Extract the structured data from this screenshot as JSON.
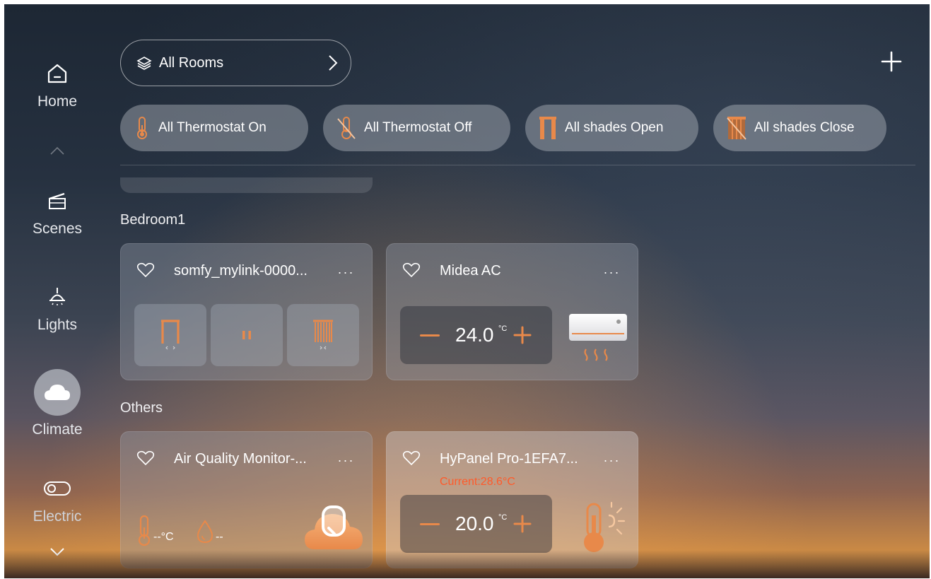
{
  "nav": {
    "items": [
      {
        "label": "Home",
        "icon": "home-icon"
      },
      {
        "label": "Scenes",
        "icon": "clapperboard-icon"
      },
      {
        "label": "Lights",
        "icon": "ceiling-lamp-icon"
      },
      {
        "label": "Climate",
        "icon": "cloud-icon",
        "active": true
      },
      {
        "label": "Electric",
        "icon": "toggle-icon"
      }
    ]
  },
  "header": {
    "rooms_label": "All Rooms",
    "rooms_icon": "layers-icon",
    "add_icon": "plus-icon"
  },
  "quick_actions": [
    {
      "label": "All Thermostat On",
      "icon": "thermometer-icon"
    },
    {
      "label": "All Thermostat Off",
      "icon": "thermometer-off-icon"
    },
    {
      "label": "All shades Open",
      "icon": "shade-open-icon"
    },
    {
      "label": "All shades Close",
      "icon": "shade-close-icon"
    }
  ],
  "sections": [
    {
      "title": "Bedroom1",
      "devices": [
        {
          "name": "somfy_mylink-0000...",
          "more": "...",
          "controls": [
            "shade-open-icon",
            "pause-icon",
            "shade-close-icon"
          ]
        },
        {
          "name": "Midea AC",
          "more": "...",
          "setpoint": "24.0",
          "unit": "°C",
          "icon": "air-conditioner-icon"
        }
      ]
    },
    {
      "title": "Others",
      "devices": [
        {
          "name": "Air Quality Monitor-...",
          "more": "...",
          "temp_reading": "--°C",
          "humidity_reading": "--",
          "icon": "air-quality-cloud-icon"
        },
        {
          "name": "HyPanel Pro-1EFA7...",
          "more": "...",
          "current": "Current:28.6°C",
          "setpoint": "20.0",
          "unit": "°C",
          "icon": "thermometer-sun-icon"
        }
      ]
    }
  ],
  "colors": {
    "accent": "#e8894a",
    "alert": "#ff5a2a"
  }
}
